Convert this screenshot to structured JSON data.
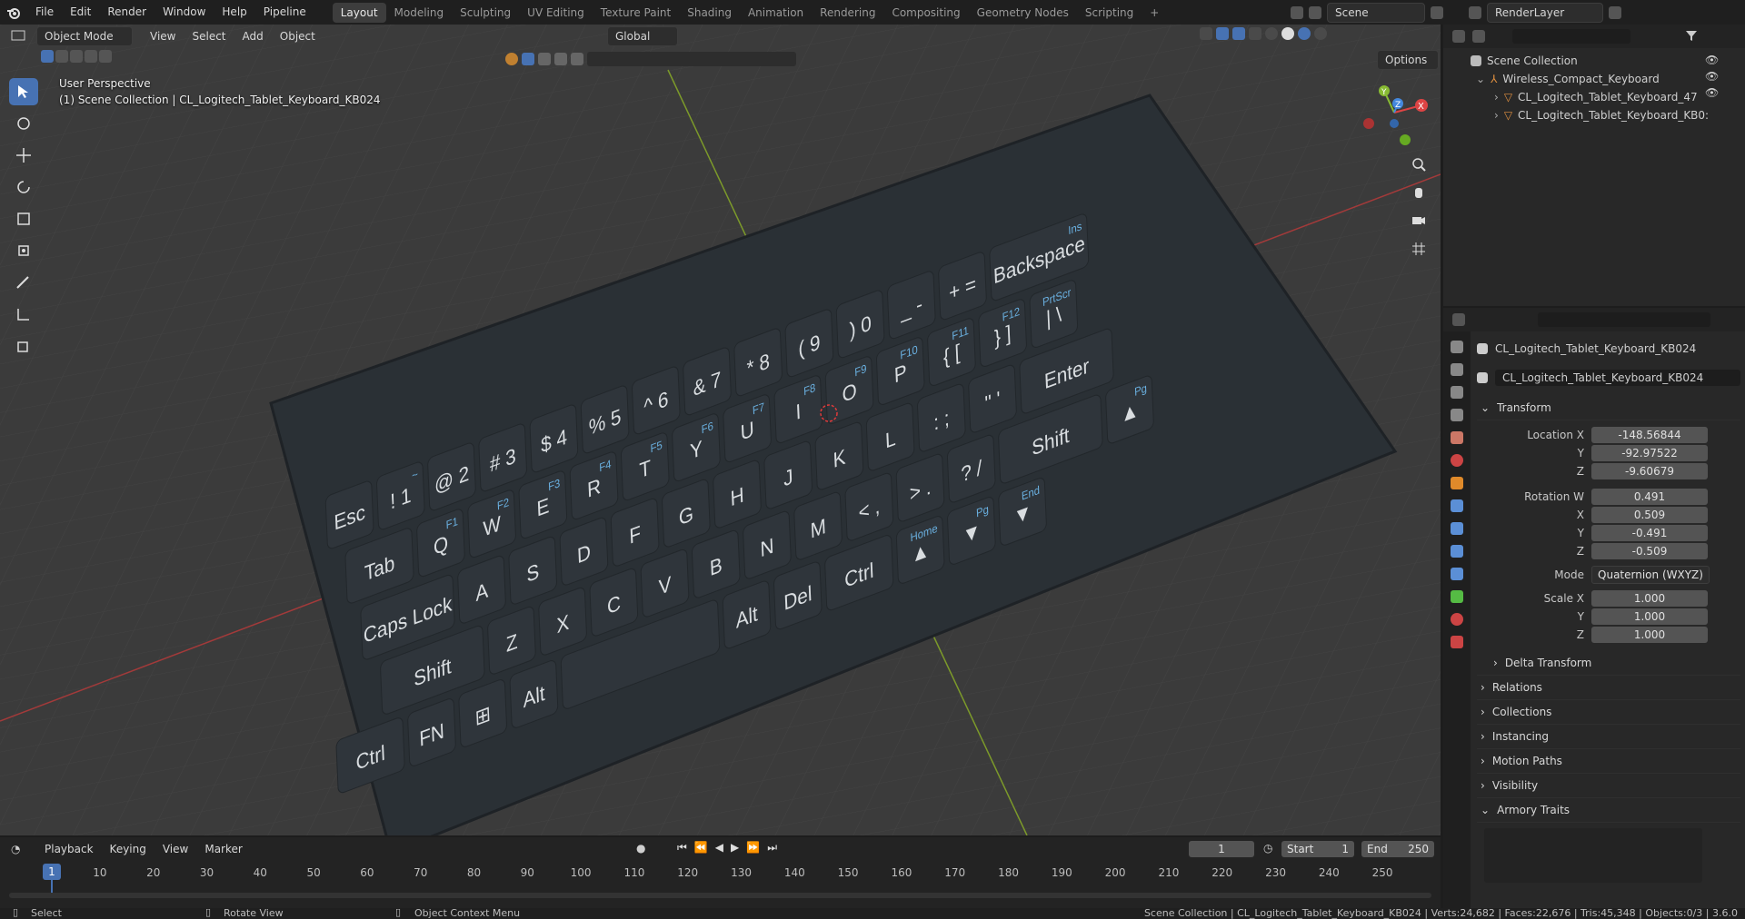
{
  "menubar": {
    "items": [
      "File",
      "Edit",
      "Render",
      "Window",
      "Help",
      "Pipeline"
    ],
    "workspaces": [
      "Layout",
      "Modeling",
      "Sculpting",
      "UV Editing",
      "Texture Paint",
      "Shading",
      "Animation",
      "Rendering",
      "Compositing",
      "Geometry Nodes",
      "Scripting"
    ],
    "active_workspace": "Layout",
    "add_tab": "+",
    "scene": "Scene",
    "render_layer": "RenderLayer"
  },
  "viewport_header": {
    "mode": "Object Mode",
    "menus": [
      "View",
      "Select",
      "Add",
      "Object"
    ],
    "transform_orientation": "Global",
    "options": "Options"
  },
  "viewport": {
    "perspective_label": "User Perspective",
    "collection_label": "(1) Scene Collection | CL_Logitech_Tablet_Keyboard_KB024",
    "gizmo": {
      "x": "X",
      "y": "Y",
      "z": "Z"
    }
  },
  "keyboard": {
    "row1": [
      {
        "main": "Esc",
        "fn": ""
      },
      {
        "main": "! 1",
        "fn": "~"
      },
      {
        "main": "@ 2",
        "fn": ""
      },
      {
        "main": "# 3",
        "fn": ""
      },
      {
        "main": "$ 4",
        "fn": ""
      },
      {
        "main": "% 5",
        "fn": ""
      },
      {
        "main": "^ 6",
        "fn": ""
      },
      {
        "main": "& 7",
        "fn": ""
      },
      {
        "main": "* 8",
        "fn": ""
      },
      {
        "main": "( 9",
        "fn": ""
      },
      {
        "main": ") 0",
        "fn": ""
      },
      {
        "main": "_ -",
        "fn": ""
      },
      {
        "main": "+ =",
        "fn": ""
      },
      {
        "main": "Backspace",
        "fn": "Ins"
      }
    ],
    "row2": [
      {
        "main": "Tab",
        "fn": ""
      },
      {
        "main": "Q",
        "fn": "F1"
      },
      {
        "main": "W",
        "fn": "F2"
      },
      {
        "main": "E",
        "fn": "F3"
      },
      {
        "main": "R",
        "fn": "F4"
      },
      {
        "main": "T",
        "fn": "F5"
      },
      {
        "main": "Y",
        "fn": "F6"
      },
      {
        "main": "U",
        "fn": "F7"
      },
      {
        "main": "I",
        "fn": "F8"
      },
      {
        "main": "O",
        "fn": "F9"
      },
      {
        "main": "P",
        "fn": "F10"
      },
      {
        "main": "{ [",
        "fn": "F11"
      },
      {
        "main": "} ]",
        "fn": "F12"
      },
      {
        "main": "| \\",
        "fn": "PrtScr"
      }
    ],
    "row3": [
      {
        "main": "Caps Lock",
        "fn": ""
      },
      {
        "main": "A",
        "fn": ""
      },
      {
        "main": "S",
        "fn": ""
      },
      {
        "main": "D",
        "fn": ""
      },
      {
        "main": "F",
        "fn": ""
      },
      {
        "main": "G",
        "fn": ""
      },
      {
        "main": "H",
        "fn": ""
      },
      {
        "main": "J",
        "fn": ""
      },
      {
        "main": "K",
        "fn": ""
      },
      {
        "main": "L",
        "fn": ""
      },
      {
        "main": ": ;",
        "fn": ""
      },
      {
        "main": "\" '",
        "fn": ""
      },
      {
        "main": "Enter",
        "fn": ""
      }
    ],
    "row4": [
      {
        "main": "Shift",
        "fn": ""
      },
      {
        "main": "Z",
        "fn": ""
      },
      {
        "main": "X",
        "fn": ""
      },
      {
        "main": "C",
        "fn": ""
      },
      {
        "main": "V",
        "fn": ""
      },
      {
        "main": "B",
        "fn": ""
      },
      {
        "main": "N",
        "fn": ""
      },
      {
        "main": "M",
        "fn": ""
      },
      {
        "main": "< ,",
        "fn": ""
      },
      {
        "main": "> .",
        "fn": ""
      },
      {
        "main": "? /",
        "fn": ""
      },
      {
        "main": "Shift",
        "fn": ""
      },
      {
        "main": "▲",
        "fn": "Pg"
      }
    ],
    "row5": [
      {
        "main": "Ctrl",
        "fn": ""
      },
      {
        "main": "FN",
        "fn": ""
      },
      {
        "main": "⊞",
        "fn": ""
      },
      {
        "main": "Alt",
        "fn": ""
      },
      {
        "main": "",
        "fn": ""
      },
      {
        "main": "Alt",
        "fn": ""
      },
      {
        "main": "Del",
        "fn": ""
      },
      {
        "main": "Ctrl",
        "fn": ""
      },
      {
        "main": "▲",
        "fn": "Home"
      },
      {
        "main": "▼",
        "fn": "Pg"
      },
      {
        "main": "▼",
        "fn": "End"
      }
    ]
  },
  "outliner": {
    "root": "Scene Collection",
    "items": [
      {
        "name": "Wireless_Compact_Keyboard",
        "level": 1
      },
      {
        "name": "CL_Logitech_Tablet_Keyboard_47",
        "level": 2
      },
      {
        "name": "CL_Logitech_Tablet_Keyboard_KB0:",
        "level": 2
      }
    ]
  },
  "properties": {
    "object_name": "CL_Logitech_Tablet_Keyboard_KB024",
    "data_name": "CL_Logitech_Tablet_Keyboard_KB024",
    "transform_label": "Transform",
    "location_label": "Location X",
    "location": {
      "x": "-148.56844",
      "y": "-92.97522",
      "z": "-9.60679"
    },
    "rotation_label": "Rotation W",
    "rotation": {
      "w": "0.491",
      "x": "0.509",
      "y": "-0.491",
      "z": "-0.509"
    },
    "mode_label": "Mode",
    "mode_value": "Quaternion (WXYZ)",
    "scale_label": "Scale X",
    "scale": {
      "x": "1.000",
      "y": "1.000",
      "z": "1.000"
    },
    "axis_labels": {
      "y": "Y",
      "z": "Z",
      "x": "X"
    },
    "panels": [
      "Delta Transform",
      "Relations",
      "Collections",
      "Instancing",
      "Motion Paths",
      "Visibility",
      "Armory Traits"
    ]
  },
  "timeline": {
    "menus": [
      "Playback",
      "Keying",
      "View",
      "Marker"
    ],
    "current_frame": "1",
    "start_label": "Start",
    "start": "1",
    "end_label": "End",
    "end": "250",
    "ticks": [
      "10",
      "20",
      "30",
      "40",
      "50",
      "60",
      "70",
      "80",
      "90",
      "100",
      "110",
      "120",
      "130",
      "140",
      "150",
      "160",
      "170",
      "180",
      "190",
      "200",
      "210",
      "220",
      "230",
      "240",
      "250"
    ],
    "cursor": "1"
  },
  "statusbar": {
    "select": "Select",
    "rotate": "Rotate View",
    "context": "Object Context Menu",
    "stats": "Scene Collection | CL_Logitech_Tablet_Keyboard_KB024 | Verts:24,682 | Faces:22,676 | Tris:45,348 | Objects:0/3 | 3.6.0"
  },
  "colors": {
    "accent": "#4772b3",
    "viewport": "#3b3b3b",
    "panel": "#282828",
    "key": "#2b3136",
    "fn_blue": "#6ab0e0"
  }
}
